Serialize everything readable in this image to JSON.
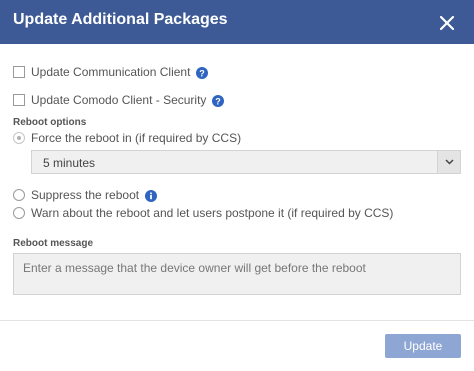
{
  "dialog": {
    "title": "Update Additional Packages",
    "close_icon": "close-icon"
  },
  "packages": [
    {
      "label": "Update Communication Client",
      "checked": false,
      "icon": "help-icon"
    },
    {
      "label": "Update Comodo Client - Security",
      "checked": false,
      "icon": "help-icon"
    }
  ],
  "reboot_options": {
    "section_label": "Reboot options",
    "force": {
      "label": "Force the reboot in (if required by CCS)",
      "selected": true,
      "disabled": true
    },
    "delay_select": {
      "value": "5 minutes",
      "icon": "chevron-down-icon"
    },
    "suppress": {
      "label": "Suppress the reboot",
      "icon": "info-icon"
    },
    "warn": {
      "label": "Warn about the reboot and let users postpone it (if required by CCS)"
    }
  },
  "reboot_message": {
    "section_label": "Reboot message",
    "placeholder": "Enter a message that the device owner will get before the reboot"
  },
  "footer": {
    "update_label": "Update"
  },
  "colors": {
    "header": "#3d5a96",
    "help_icon": "#2f64c0",
    "update_button": "#8ea6d4"
  }
}
